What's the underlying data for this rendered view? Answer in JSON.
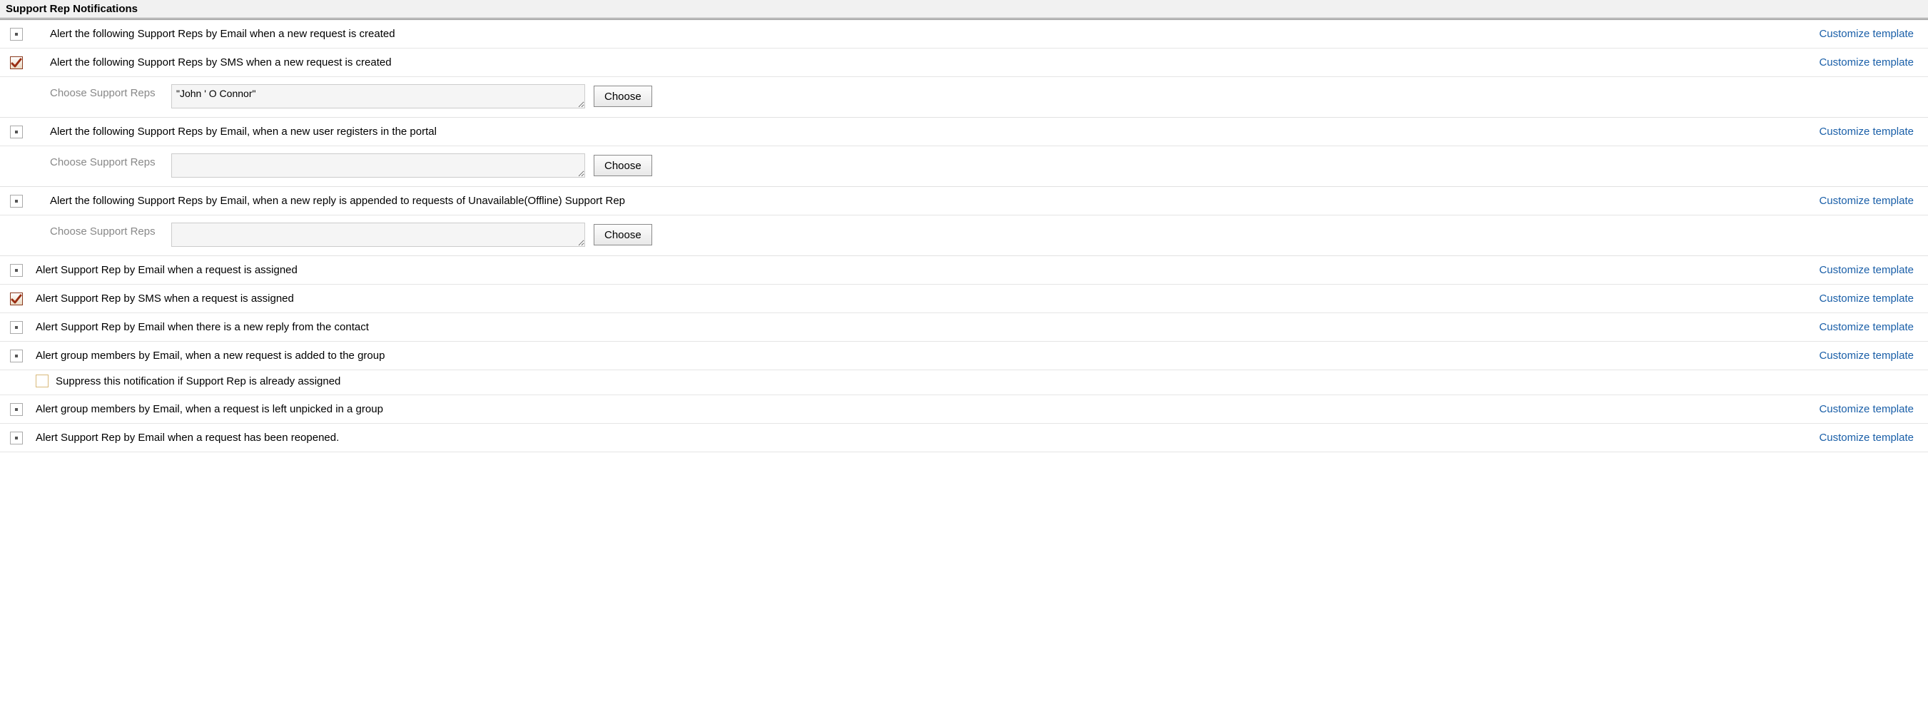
{
  "header": "Support Rep Notifications",
  "customize_label": "Customize template",
  "choose_label": "Choose Support Reps",
  "choose_btn": "Choose",
  "rows": [
    {
      "id": "email-new-request",
      "cb": "dot",
      "label": "Alert the following Support Reps by Email when a new request is created"
    },
    {
      "id": "sms-new-request",
      "cb": "checked",
      "label": "Alert the following Support Reps by SMS when a new request is created",
      "detail_value": "\"John ' O Connor\""
    },
    {
      "id": "email-new-user",
      "cb": "dot",
      "label": "Alert the following Support Reps by Email, when a new user registers in the portal",
      "detail_value": ""
    },
    {
      "id": "email-offline-reply",
      "cb": "dot",
      "label": "Alert the following Support Reps by Email, when a new reply is appended to requests of Unavailable(Offline) Support Rep",
      "detail_value": ""
    },
    {
      "id": "email-assigned",
      "cb": "dot",
      "label": "Alert Support Rep by Email when a request is assigned",
      "narrow": true
    },
    {
      "id": "sms-assigned",
      "cb": "checked",
      "label": "Alert Support Rep by SMS when a request is assigned",
      "narrow": true
    },
    {
      "id": "email-new-reply",
      "cb": "dot",
      "label": "Alert Support Rep by Email when there is a new reply from the contact",
      "narrow": true
    },
    {
      "id": "email-group-new",
      "cb": "dot",
      "label": "Alert group members by Email, when a new request is added to the group",
      "narrow": true,
      "sub_opt": {
        "cb": "empty",
        "label": "Suppress this notification if Support Rep is already assigned"
      }
    },
    {
      "id": "email-group-unpicked",
      "cb": "dot",
      "label": "Alert group members by Email, when a request is left unpicked in a group",
      "narrow": true
    },
    {
      "id": "email-reopened",
      "cb": "dot",
      "label": "Alert Support Rep by Email when a request has been reopened.",
      "narrow": true
    }
  ]
}
